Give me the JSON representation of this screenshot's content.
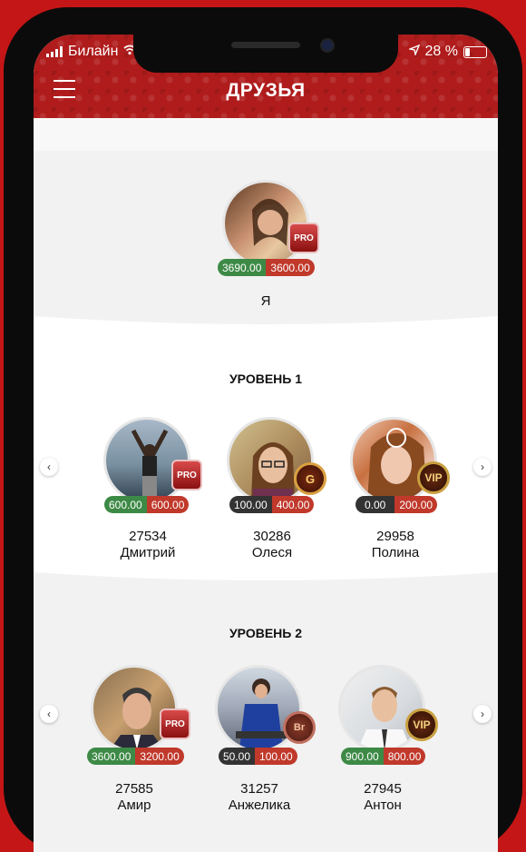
{
  "status": {
    "carrier": "Билайн",
    "battery": "28 %"
  },
  "header": {
    "title": "ДРУЗЬЯ"
  },
  "me": {
    "balance_green": "3690.00",
    "balance_red": "3600.00",
    "badge": "PRO",
    "label": "Я"
  },
  "level1": {
    "title": "УРОВЕНЬ 1",
    "friends": [
      {
        "id": "27534",
        "name": "Дмитрий",
        "bal1": "600.00",
        "bal2": "600.00",
        "badge": "PRO"
      },
      {
        "id": "30286",
        "name": "Олеся",
        "bal1": "100.00",
        "bal2": "400.00",
        "badge": "G"
      },
      {
        "id": "29958",
        "name": "Полина",
        "bal1": "0.00",
        "bal2": "200.00",
        "badge": "VIP"
      }
    ]
  },
  "level2": {
    "title": "УРОВЕНЬ 2",
    "friends": [
      {
        "id": "27585",
        "name": "Амир",
        "bal1": "3600.00",
        "bal2": "3200.00",
        "badge": "PRO"
      },
      {
        "id": "31257",
        "name": "Анжелика",
        "bal1": "50.00",
        "bal2": "100.00",
        "badge": "Br"
      },
      {
        "id": "27945",
        "name": "Антон",
        "bal1": "900.00",
        "bal2": "800.00",
        "badge": "VIP"
      }
    ]
  },
  "colors": {
    "header": "#b01c1c",
    "positive": "#3d8a46",
    "negative": "#c0392b",
    "zero": "#333333"
  }
}
